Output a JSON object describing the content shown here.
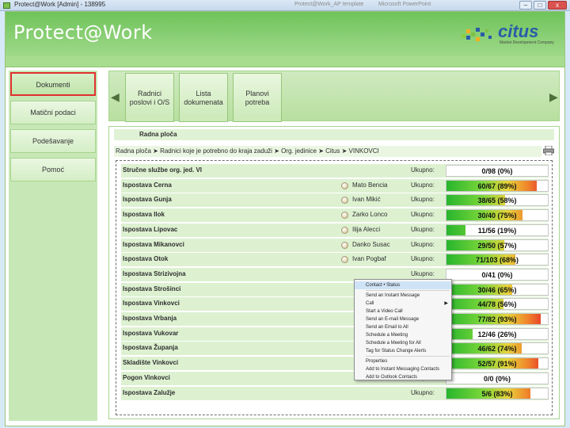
{
  "window": {
    "title": "Protect@Work [Admin] - 138995",
    "ghost_tabs": [
      "Protect@Work_AP template",
      "Microsoft PowerPoint"
    ],
    "buttons": [
      "–",
      "□",
      "x"
    ]
  },
  "header": {
    "app_title": "Protect@Work",
    "logo_word": "citus",
    "logo_tagline": "Market Development Company"
  },
  "sidebar": {
    "items": [
      {
        "label": "Dokumenti",
        "active": true
      },
      {
        "label": "Matični podaci",
        "active": false
      },
      {
        "label": "Podešavanje",
        "active": false
      },
      {
        "label": "Pomoć",
        "active": false
      }
    ]
  },
  "toolbar": {
    "buttons": [
      {
        "label": "Radnici poslovi i O/S"
      },
      {
        "label": "Lista dokumenata"
      },
      {
        "label": "Planovi potreba"
      }
    ]
  },
  "panel": {
    "title": "Radna ploča",
    "breadcrumb": "Radna ploča ➤ Radnici koje je potrebno do kraja zaduži ➤ Org. jedinice ➤ Citus ➤ VINKOVCI"
  },
  "rows": [
    {
      "name": "Stručne službe org. jed. VI",
      "person": "",
      "ukupno": "Ukupno:",
      "value": "0/98 (0%)",
      "pct": 0
    },
    {
      "name": "Ispostava Cerna",
      "person": "Mato Bencia",
      "ukupno": "Ukupno:",
      "value": "60/67 (89%)",
      "pct": 89
    },
    {
      "name": "Ispostava Gunja",
      "person": "Ivan Mikić",
      "ukupno": "Ukupno:",
      "value": "38/65 (58%)",
      "pct": 58
    },
    {
      "name": "Ispostava Ilok",
      "person": "Zarko Lonco",
      "ukupno": "Ukupno:",
      "value": "30/40 (75%)",
      "pct": 75
    },
    {
      "name": "Ispostava Lipovac",
      "person": "Ilija Alecci",
      "ukupno": "Ukupno:",
      "value": "11/56 (19%)",
      "pct": 19
    },
    {
      "name": "Ispostava Mikanovci",
      "person": "Danko Susac",
      "ukupno": "Ukupno:",
      "value": "29/50 (57%)",
      "pct": 57
    },
    {
      "name": "Ispostava Otok",
      "person": "Ivan Pogbaf",
      "ukupno": "Ukupno:",
      "value": "71/103 (68%)",
      "pct": 68
    },
    {
      "name": "Ispostava Strizivojna",
      "person": "",
      "ukupno": "Ukupno:",
      "value": "0/41 (0%)",
      "pct": 0
    },
    {
      "name": "Ispostava Strošinci",
      "person": "",
      "ukupno": "Ukupno:",
      "value": "30/46 (65%)",
      "pct": 65
    },
    {
      "name": "Ispostava Vinkovci",
      "person": "",
      "ukupno": "Ukupno:",
      "value": "44/78 (56%)",
      "pct": 56
    },
    {
      "name": "Ispostava Vrbanja",
      "person": "",
      "ukupno": "Ukupno:",
      "value": "77/82 (93%)",
      "pct": 93
    },
    {
      "name": "Ispostava Vukovar",
      "person": "",
      "ukupno": "Ukupno:",
      "value": "12/46 (26%)",
      "pct": 26
    },
    {
      "name": "Ispostava Županja",
      "person": "",
      "ukupno": "Ukupno:",
      "value": "46/62 (74%)",
      "pct": 74
    },
    {
      "name": "Skladište Vinkovci",
      "person": "",
      "ukupno": "Ukupno:",
      "value": "52/57 (91%)",
      "pct": 91
    },
    {
      "name": "Pogon Vinkovci",
      "person": "",
      "ukupno": "Ukupno:",
      "value": "0/0 (0%)",
      "pct": 0
    },
    {
      "name": "Ispostava Zalužje",
      "person": "",
      "ukupno": "Ukupno:",
      "value": "5/6 (83%)",
      "pct": 83
    }
  ],
  "context_menu": {
    "items": [
      {
        "label": "Contact • Status",
        "highlight": true
      },
      {
        "label": "Send an Instant Message",
        "highlight": false
      },
      {
        "label": "Call",
        "highlight": false,
        "submenu": true
      },
      {
        "label": "Start a Video Call",
        "highlight": false
      },
      {
        "label": "Send an E-mail Message",
        "highlight": false
      },
      {
        "label": "Send an Email to All",
        "highlight": false
      },
      {
        "label": "Schedule a Meeting",
        "highlight": false
      },
      {
        "label": "Schedule a Meeting for All",
        "highlight": false
      },
      {
        "label": "Tag for Status Change Alerts",
        "highlight": false
      },
      {
        "label": "Properties",
        "highlight": false
      },
      {
        "label": "Add to Instant Messaging Contacts",
        "highlight": false
      },
      {
        "label": "Add to Outlook Contacts",
        "highlight": false
      }
    ]
  },
  "colors": {
    "header_green": "#6fc35a",
    "active_border": "#e03030",
    "bar_low": "#27b52d",
    "bar_high": "#e4262a"
  }
}
